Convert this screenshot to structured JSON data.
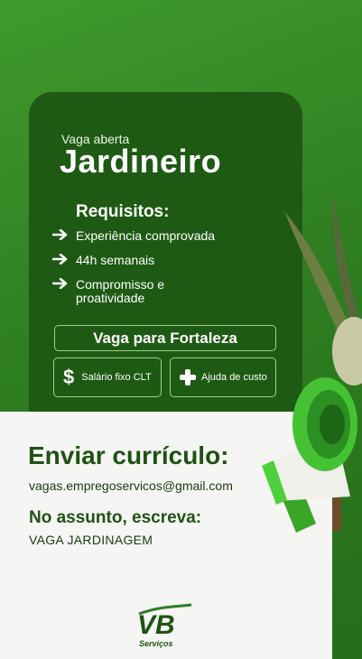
{
  "header": {
    "subtitle": "Vaga aberta",
    "title": "Jardineiro"
  },
  "requirements": {
    "title": "Requisitos:",
    "items": [
      "Experiência comprovada",
      "44h semanais",
      "Compromisso e proatividade"
    ]
  },
  "location": "Vaga para Fortaleza",
  "benefits": [
    {
      "icon": "dollar-icon",
      "label": "Salário fixo CLT"
    },
    {
      "icon": "plus-icon",
      "label": "Ajuda de custo"
    }
  ],
  "apply": {
    "title": "Enviar currículo:",
    "email": "vagas.empregoservicos@gmail.com",
    "subject_title": "No assunto, escreva:",
    "subject_value": "VAGA JARDINAGEM"
  },
  "brand": {
    "logo": "VB",
    "name": "Serviços"
  },
  "colors": {
    "background": "#2f7f22",
    "card": "#1e5a14",
    "accent": "#5ad64a",
    "panel": "#f5f5f3",
    "text_dark": "#1f5214"
  }
}
